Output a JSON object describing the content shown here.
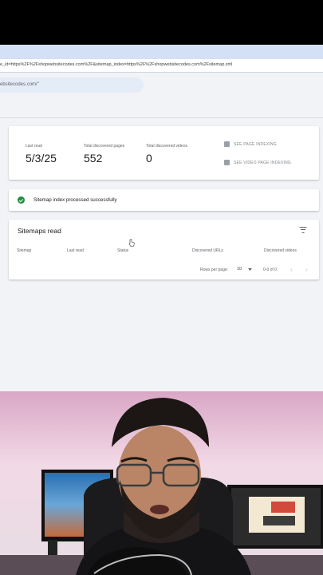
{
  "browser": {
    "url": "e_id=https%2F%2Fshopwebsitecodes.com%2F&sitemap_index=https%2F%2Fshopwebsitecodes.com%2Fsitemap.xml"
  },
  "search": {
    "value": "ebsitecodes.com/\""
  },
  "stats": {
    "last_read_label": "Last read",
    "last_read_value": "5/3/25",
    "pages_label": "Total discovered pages",
    "pages_value": "552",
    "videos_label": "Total discovered videos",
    "videos_value": "0",
    "see_page_indexing": "SEE PAGE INDEXING",
    "see_video_indexing": "SEE VIDEO PAGE INDEXING"
  },
  "status": {
    "message": "Sitemap index processed successfully"
  },
  "sitemaps": {
    "title": "Sitemaps read",
    "columns": [
      "Sitemap",
      "Last read",
      "Status",
      "Discovered URLs",
      "Discovered videos"
    ],
    "rows_per_page_label": "Rows per page:",
    "rows_per_page_value": "10",
    "range": "0-0 of 0"
  },
  "icons": [
    "check-circle-icon",
    "filter-icon",
    "page-indexing-icon",
    "video-indexing-icon",
    "chevron-left-icon",
    "chevron-right-icon",
    "dropdown-arrow-icon",
    "pointer-cursor-icon"
  ],
  "colors": {
    "success_green": "#1e8e3e",
    "link_gray": "#80868b",
    "page_bg": "#f1f3f6"
  }
}
